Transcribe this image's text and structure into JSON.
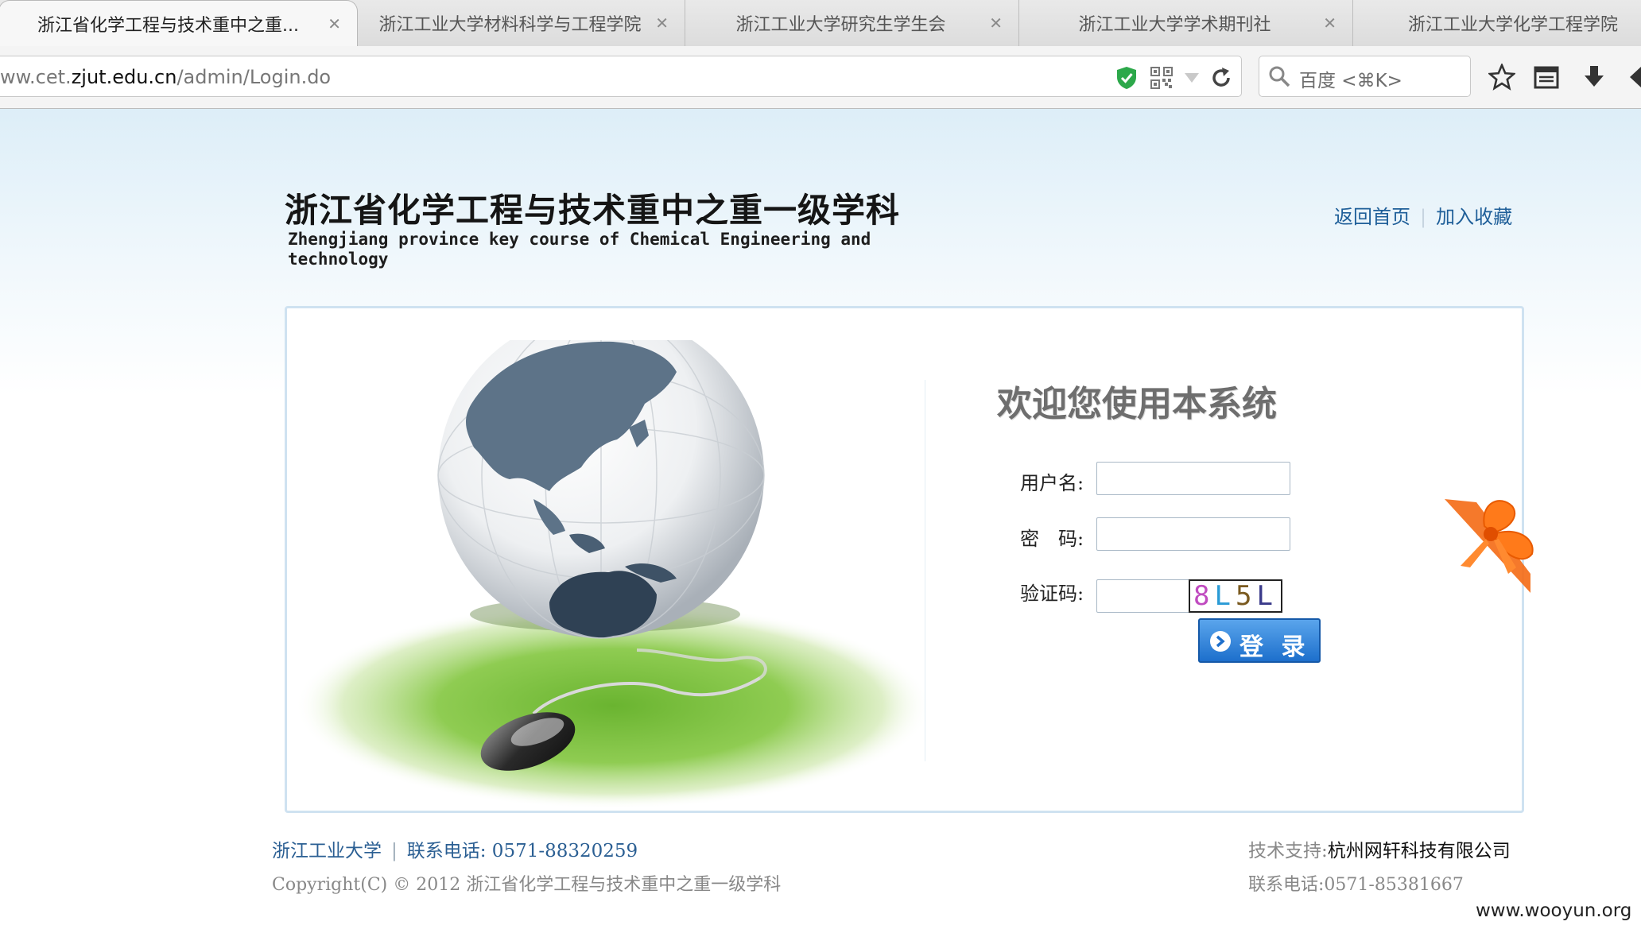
{
  "browser": {
    "tabs": [
      {
        "title": "浙江省化学工程与技术重中之重...",
        "active": true
      },
      {
        "title": "浙江工业大学材料科学与工程学院",
        "active": false
      },
      {
        "title": "浙江工业大学研究生学生会",
        "active": false
      },
      {
        "title": "浙江工业大学学术期刊社",
        "active": false
      },
      {
        "title": "浙江工业大学化学工程学院",
        "active": false
      }
    ],
    "close_glyph": "✕",
    "url_prefix": "ww.cet.",
    "url_host": "zjut.edu.cn",
    "url_path": "/admin/Login.do",
    "search_placeholder": "百度 <⌘K>",
    "icons": [
      "shield-icon",
      "qr-code-icon",
      "dropdown-icon",
      "reload-icon",
      "search-icon",
      "star-icon",
      "reader-icon",
      "download-icon",
      "back-icon"
    ]
  },
  "header": {
    "title": "浙江省化学工程与技术重中之重一级学科",
    "subtitle": "Zhengjiang province key course of Chemical Engineering and technology",
    "links": {
      "home": "返回首页",
      "bookmark": "加入收藏"
    }
  },
  "login": {
    "welcome": "欢迎您使用本系统",
    "username_label": "用户名:",
    "password_label": "密　码:",
    "captcha_label": "验证码:",
    "captcha_text": [
      "8",
      "L",
      "5",
      "L"
    ],
    "captcha_colors": [
      "#c04bc0",
      "#2a9bd6",
      "#7a5a20",
      "#3a3a8a"
    ],
    "login_button": "登 录"
  },
  "footer": {
    "university": "浙江工业大学",
    "contact": "联系电话: 0571-88320259",
    "copyright": "Copyright(C) © 2012 浙江省化学工程与技术重中之重一级学科",
    "support_label": "技术支持:",
    "support_company": "杭州网轩科技有限公司",
    "support_phone": "联系电话:0571-85381667"
  },
  "watermark": "www.wooyun.org",
  "colors": {
    "link": "#1f5f99",
    "button": "#1d6fcc",
    "box_border": "#cfe2f1"
  }
}
